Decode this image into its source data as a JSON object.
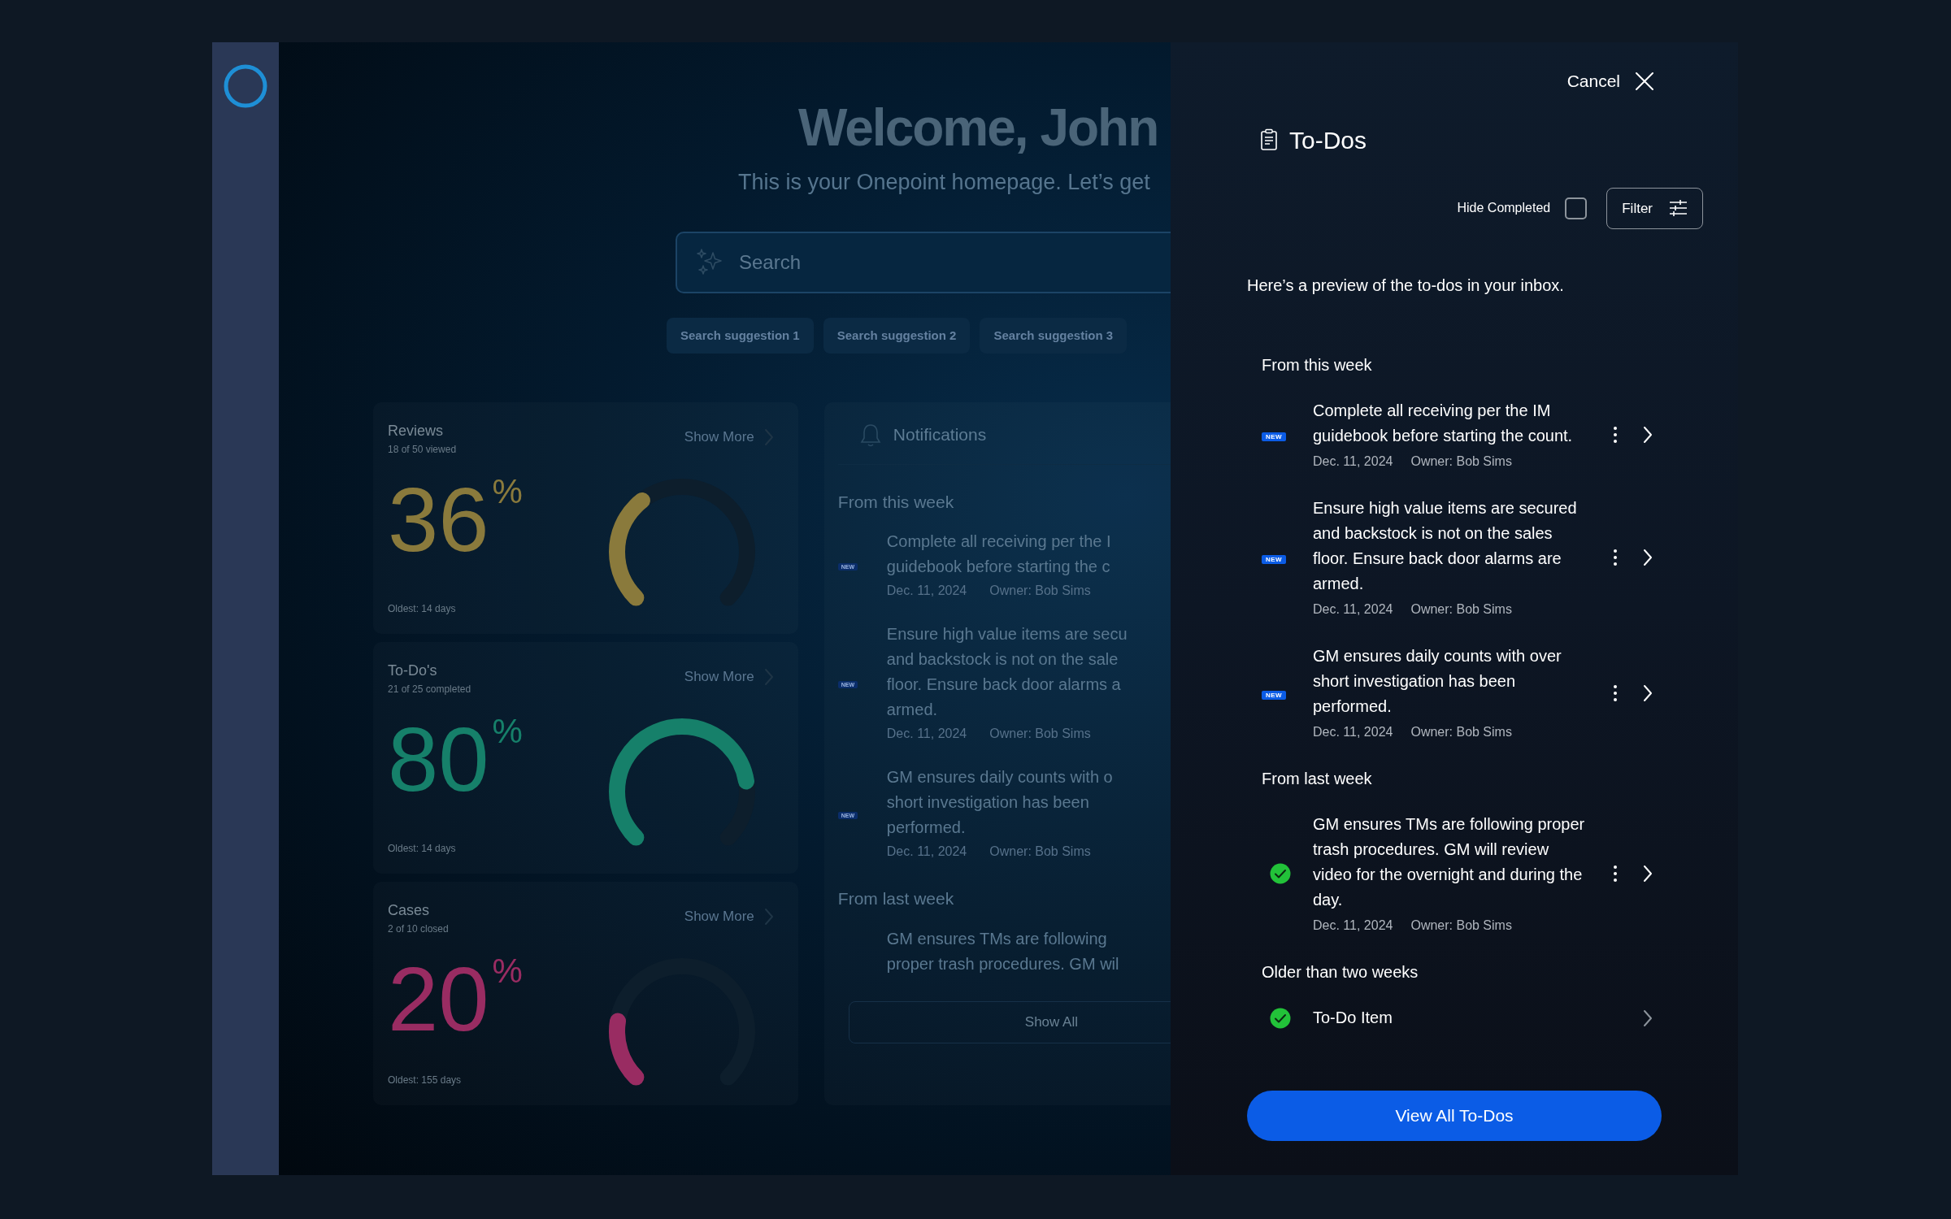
{
  "dashboard": {
    "title": "Welcome, John",
    "subtitle": "This is your Onepoint homepage. Let’s get",
    "search": {
      "placeholder": "Search"
    },
    "suggestions": [
      "Search suggestion 1",
      "Search suggestion 2",
      "Search suggestion 3"
    ],
    "stat_cards": [
      {
        "title": "Reviews",
        "subtitle": "18 of 50 viewed",
        "value": "36",
        "unit": "%",
        "footer": "Oldest: 14 days",
        "link": "Show More",
        "color": "#8a7a3c"
      },
      {
        "title": "To-Do's",
        "subtitle": "21 of 25 completed",
        "value": "80",
        "unit": "%",
        "footer": "Oldest: 14 days",
        "link": "Show More",
        "color": "#16806a"
      },
      {
        "title": "Cases",
        "subtitle": "2 of 10 closed",
        "value": "20",
        "unit": "%",
        "footer": "Oldest: 155 days",
        "link": "Show More",
        "color": "#992c62"
      }
    ],
    "notifications": {
      "title": "Notifications",
      "sections": [
        {
          "heading": "From this week",
          "items": [
            {
              "kind": "new",
              "badge": "NEW",
              "lines": [
                "Complete all receiving per the I",
                "guidebook before starting the c"
              ],
              "date": "Dec. 11, 2024",
              "owner": "Owner: Bob Sims"
            },
            {
              "kind": "new",
              "badge": "NEW",
              "lines": [
                "Ensure high value items are secu",
                "and backstock is not on the sale",
                "floor. Ensure back door alarms a",
                "armed."
              ],
              "date": "Dec. 11, 2024",
              "owner": "Owner: Bob Sims"
            },
            {
              "kind": "new",
              "badge": "NEW",
              "lines": [
                "GM ensures daily counts with o",
                "short investigation has been",
                "performed."
              ],
              "date": "Dec. 11, 2024",
              "owner": "Owner: Bob Sims"
            }
          ]
        },
        {
          "heading": "From last week",
          "items": [
            {
              "kind": "plain",
              "lines": [
                "GM ensures TMs are following",
                "proper trash procedures. GM wil"
              ]
            }
          ]
        }
      ],
      "show_all": "Show All"
    }
  },
  "drawer": {
    "cancel": "Cancel",
    "title": "To-Dos",
    "hide_completed": {
      "label": "Hide Completed",
      "checked": false
    },
    "filter": "Filter",
    "intro": "Here’s a preview of the to-dos in your inbox.",
    "sections": [
      {
        "heading": "From this week",
        "items": [
          {
            "kind": "new",
            "badge": "NEW",
            "text": "Complete all receiving per the IM guidebook before starting the count.",
            "date": "Dec. 11, 2024",
            "owner": "Owner: Bob Sims",
            "has_menu": true
          },
          {
            "kind": "new",
            "badge": "NEW",
            "text": "Ensure high value items are secured and backstock is not on the sales floor. Ensure back door alarms are armed.",
            "date": "Dec. 11, 2024",
            "owner": "Owner: Bob Sims",
            "has_menu": true
          },
          {
            "kind": "new",
            "badge": "NEW",
            "text": "GM ensures daily counts with over short investigation has been performed.",
            "date": "Dec. 11, 2024",
            "owner": "Owner: Bob Sims",
            "has_menu": true
          }
        ]
      },
      {
        "heading": "From last week",
        "items": [
          {
            "kind": "done",
            "text": "GM ensures TMs are following proper trash procedures. GM will review video for the overnight and during the day.",
            "date": "Dec. 11, 2024",
            "owner": "Owner: Bob Sims",
            "has_menu": true
          }
        ]
      },
      {
        "heading": "Older than two weeks",
        "items": [
          {
            "kind": "done",
            "text": "To-Do Item",
            "has_menu": false
          }
        ]
      }
    ],
    "view_all": "View All To-Dos"
  }
}
